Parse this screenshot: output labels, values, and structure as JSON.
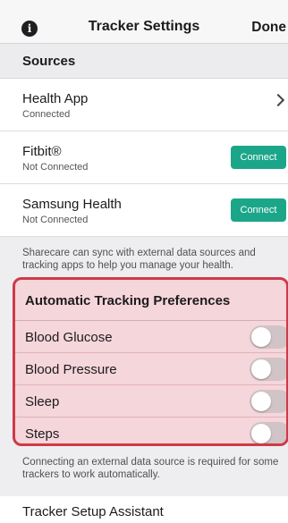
{
  "nav": {
    "title": "Tracker Settings",
    "done_label": "Done",
    "info_icon": "info-icon"
  },
  "sources_section": {
    "header": "Sources",
    "items": [
      {
        "title": "Health App",
        "status": "Connected",
        "action": "chevron-right-icon"
      },
      {
        "title": "Fitbit®",
        "status": "Not Connected",
        "button": "Connect"
      },
      {
        "title": "Samsung Health",
        "status": "Not Connected",
        "button": "Connect"
      }
    ],
    "footer": "Sharecare can sync with external data sources and tracking apps to help you manage your health."
  },
  "tracking_section": {
    "header": "Automatic Tracking Preferences",
    "toggles": [
      {
        "label": "Blood Glucose",
        "on": false
      },
      {
        "label": "Blood Pressure",
        "on": false
      },
      {
        "label": "Sleep",
        "on": false
      },
      {
        "label": "Steps",
        "on": false
      }
    ],
    "footer": "Connecting an external data source is required for some trackers to work automatically."
  },
  "assistant": {
    "label": "Tracker Setup Assistant"
  },
  "colors": {
    "accent": "#1ca689",
    "highlight_border": "#cf3a49",
    "highlight_fill": "#f5d6da"
  }
}
